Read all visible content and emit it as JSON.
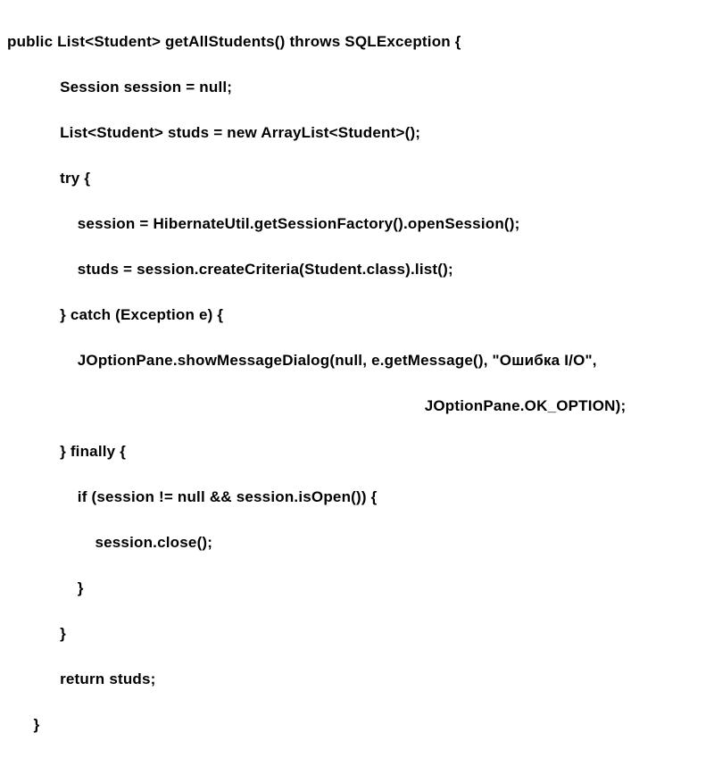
{
  "code": {
    "l1": "public List<Student> getAllStudents() throws SQLException {",
    "l2": "            Session session = null;",
    "l3": "            List<Student> studs = new ArrayList<Student>();",
    "l4": "            try {",
    "l5": "                session = HibernateUtil.getSessionFactory().openSession();",
    "l6": "                studs = session.createCriteria(Student.class).list();",
    "l7": "            } catch (Exception e) {",
    "l8": "                JOptionPane.showMessageDialog(null, e.getMessage(), \"Ошибка I/O\",",
    "l9": "                                                                                               JOptionPane.OK_OPTION);",
    "l10": "            } finally {",
    "l11": "                if (session != null && session.isOpen()) {",
    "l12": "                    session.close();",
    "l13": "                }",
    "l14": "            }",
    "l15": "            return studs;",
    "l16": "      }"
  }
}
